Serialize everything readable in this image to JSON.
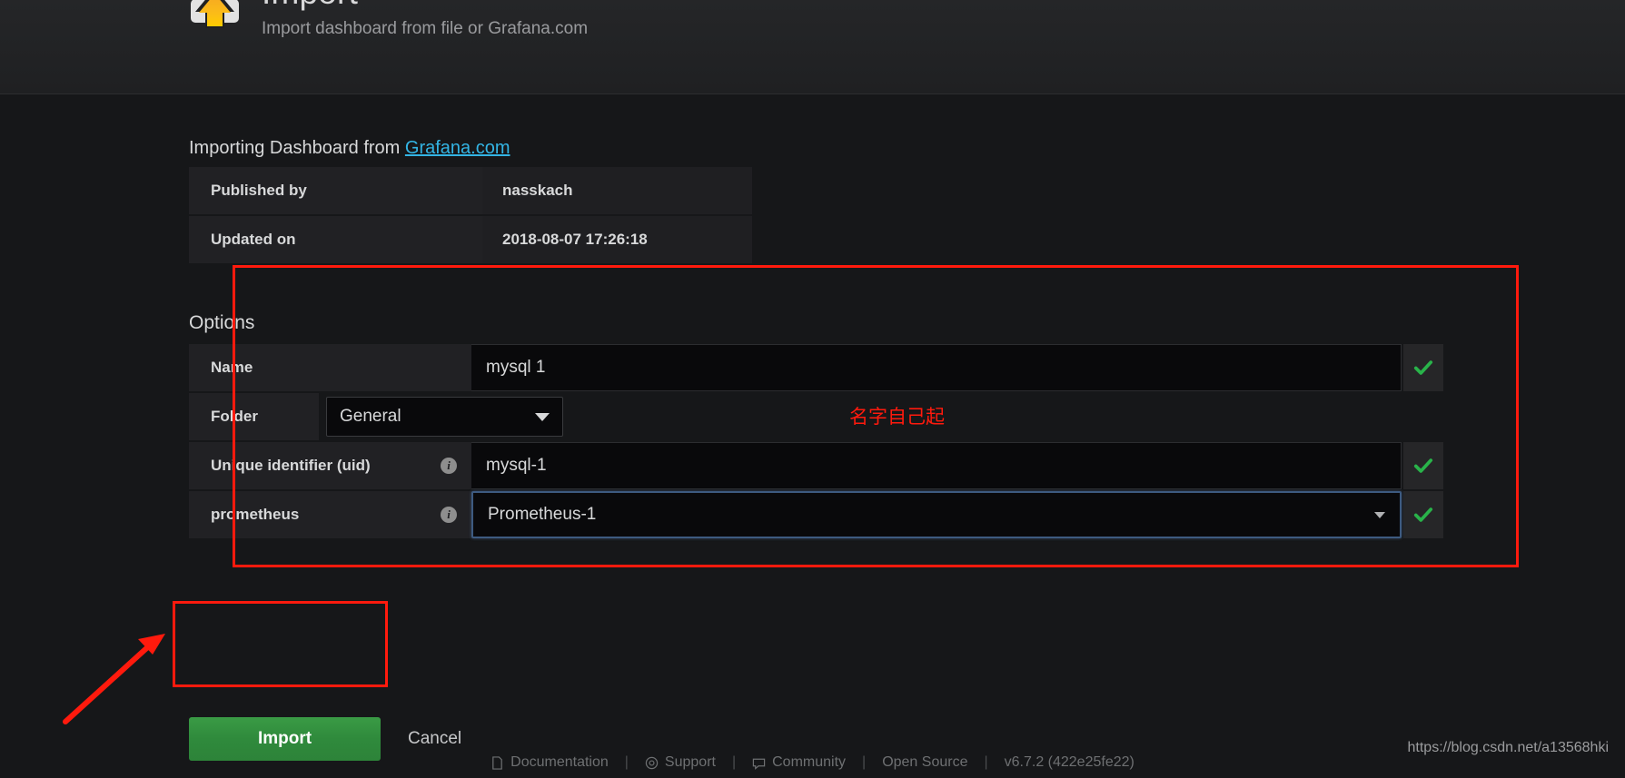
{
  "header": {
    "title": "Import",
    "subtitle": "Import dashboard from file or Grafana.com",
    "icon": "dashboard-upload-icon"
  },
  "importing": {
    "prefix": "Importing Dashboard from ",
    "link_label": "Grafana.com"
  },
  "info_table": {
    "rows": [
      {
        "key": "Published by",
        "value": "nasskach"
      },
      {
        "key": "Updated on",
        "value": "2018-08-07 17:26:18"
      }
    ]
  },
  "options": {
    "title": "Options",
    "name_field": {
      "label": "Name",
      "value": "mysql 1",
      "placeholder": "Name",
      "valid": true
    },
    "folder_field": {
      "label": "Folder",
      "value": "General",
      "options": [
        "General"
      ]
    },
    "uid_field": {
      "label": "Unique identifier (uid)",
      "info": "i",
      "value": "mysql-1",
      "placeholder": "uid",
      "valid": true
    },
    "datasource_field": {
      "label": "prometheus",
      "info": "i",
      "value": "Prometheus-1",
      "options": [
        "Prometheus-1"
      ],
      "valid": true
    }
  },
  "actions": {
    "import_label": "Import",
    "cancel_label": "Cancel"
  },
  "annotations": {
    "chinese_note": "名字自己起",
    "color": "#ff1a0d"
  },
  "footer": {
    "items": [
      {
        "label": "Documentation",
        "icon": "document-icon"
      },
      {
        "label": "Support",
        "icon": "lifebuoy-icon"
      },
      {
        "label": "Community",
        "icon": "comment-icon"
      },
      {
        "label": "Open Source",
        "icon": "none"
      },
      {
        "label": "v6.7.2 (422e25fe22)",
        "icon": "none"
      }
    ],
    "separator": "|"
  },
  "watermark": "https://blog.csdn.net/a13568hki"
}
